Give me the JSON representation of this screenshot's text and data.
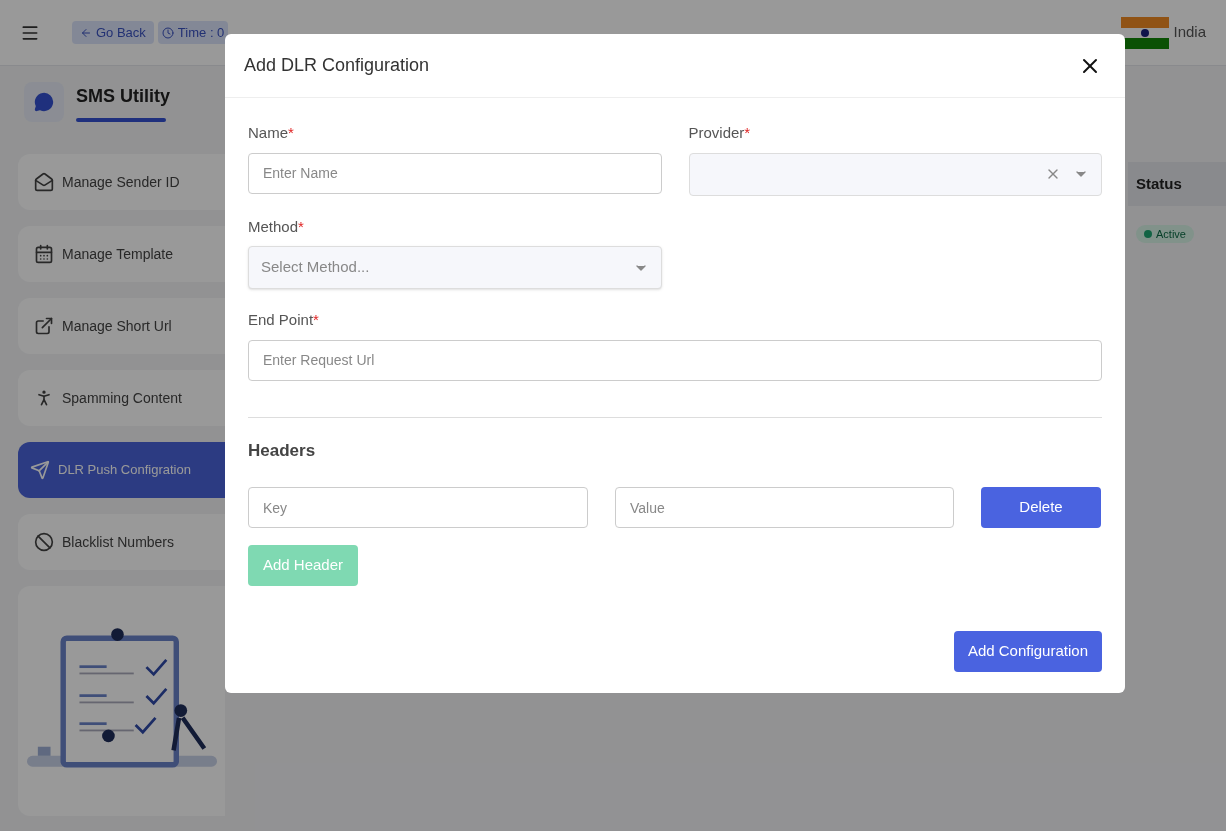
{
  "header": {
    "back": "Go Back",
    "time": "Time : 0",
    "country": "India"
  },
  "sidebar": {
    "title": "SMS Utility",
    "items": [
      {
        "label": "Manage Sender ID",
        "selected": false
      },
      {
        "label": "Manage Template",
        "selected": false
      },
      {
        "label": "Manage Short Url",
        "selected": false
      },
      {
        "label": "Spamming Content",
        "selected": false
      },
      {
        "label": "DLR Push Configration",
        "selected": true
      },
      {
        "label": "Blacklist Numbers",
        "selected": false
      }
    ]
  },
  "table": {
    "column": "Status",
    "status": {
      "label": "Active"
    }
  },
  "modal": {
    "title": "Add DLR Configuration",
    "name": {
      "label": "Name",
      "required": "*",
      "placeholder": "Enter Name"
    },
    "provider": {
      "label": "Provider",
      "required": "*"
    },
    "method": {
      "label": "Method",
      "required": "*",
      "placeholder": "Select Method..."
    },
    "endpoint": {
      "label": "End Point",
      "required": "*",
      "placeholder": "Enter Request Url"
    },
    "headers_title": "Headers",
    "headers": [
      {
        "key_placeholder": "Key",
        "value_placeholder": "Value",
        "delete": "Delete"
      }
    ],
    "add_header": {
      "label": "Add Header",
      "disabled": true
    },
    "submit": "Add Configuration"
  }
}
